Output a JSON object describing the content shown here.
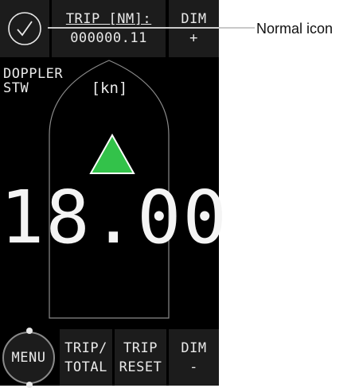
{
  "header": {
    "status_icon": "check-circle-icon",
    "trip_label": "TRIP [NM]:",
    "trip_value": "000000.11",
    "dim_label": "DIM",
    "dim_sign": "+"
  },
  "display": {
    "mode_line1": "DOPPLER",
    "mode_line2": "STW",
    "unit": "[kn]",
    "direction_icon": "up-arrow-icon",
    "speed": "18.00"
  },
  "footer": {
    "menu_label": "MENU",
    "trip_total_line1": "TRIP/",
    "trip_total_line2": "TOTAL",
    "trip_reset_line1": "TRIP",
    "trip_reset_line2": "RESET",
    "dim_label": "DIM",
    "dim_sign": "-"
  },
  "callout": {
    "label": "Normal icon"
  },
  "colors": {
    "screen_bg": "#000000",
    "panel_bg": "#1c1c1c",
    "text": "#e9e9e9",
    "arrow": "#33c24a"
  }
}
